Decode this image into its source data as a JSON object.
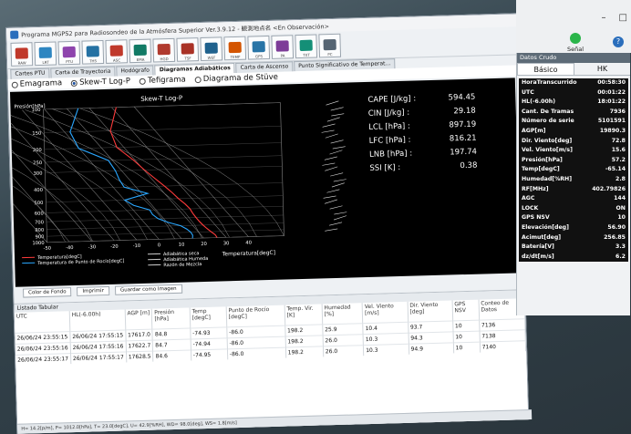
{
  "window": {
    "title": "Programa MGPS2 para Radiosondeo de la Atmósfera Superior Ver.3.9.12 - 観測地点名 <En Observación>"
  },
  "toolbar": {
    "buttons": [
      "RAW",
      "LRT",
      "PTU",
      "THS",
      "ASC",
      "EMA",
      "HGD",
      "TSF",
      "WEF",
      "TEMP",
      "GPS",
      "PA",
      "TXT",
      "PC"
    ]
  },
  "tabs": [
    "Cartes PTU",
    "Carta de Trayectoria",
    "Hodógrafo",
    "Diagramas Adiabáticos",
    "Carta de Ascenso",
    "Punto Significativo de Temperat..."
  ],
  "diagram_types": [
    "Emagrama",
    "Skew-T Log-P",
    "Tefigrama",
    "Diagrama de Stüve"
  ],
  "selected_diagram": "Skew-T Log-P",
  "plot": {
    "title": "Skew-T Log-P",
    "ylabel": "Presión[hPa]",
    "xlabel": "Temperatura[degC]",
    "pressure_ticks": [
      "100",
      "150",
      "200",
      "250",
      "300",
      "400",
      "500",
      "600",
      "700",
      "800",
      "900",
      "1000"
    ],
    "temp_ticks": [
      "-50",
      "-40",
      "-30",
      "-20",
      "-10",
      "0",
      "10",
      "20",
      "30",
      "40"
    ],
    "legend": [
      {
        "label": "Temperatura[degC]",
        "color": "#ff3b3b"
      },
      {
        "label": "Temperatura de Punto de Rocío[degC]",
        "color": "#2aa7ff"
      },
      {
        "label": "Adiabática seca",
        "color": "#cccccc"
      },
      {
        "label": "Adiabática Humeda",
        "color": "#cccccc"
      },
      {
        "label": "Razón de Mezcla",
        "color": "#cccccc"
      }
    ],
    "indices": [
      {
        "label": "CAPE [J/kg] :",
        "value": "594.45"
      },
      {
        "label": "CIN [J/kg] :",
        "value": "29.18"
      },
      {
        "label": "LCL [hPa] :",
        "value": "897.19"
      },
      {
        "label": "LFC [hPa] :",
        "value": "816.21"
      },
      {
        "label": "LNB [hPa] :",
        "value": "197.74"
      },
      {
        "label": "SSI [K] :",
        "value": "0.38"
      }
    ]
  },
  "buttons": [
    "Color de Fondo",
    "Imprimir",
    "Guardar como Imagen"
  ],
  "tabular": {
    "title": "Listado Tabular",
    "columns": [
      "UTC",
      "HL(-6.00h)",
      "AGP [m]",
      "Presión [hPa]",
      "Temp [degC]",
      "Punto de Rocío [degC]",
      "Temp. Vir. [K]",
      "Humedad [%]",
      "Vel. Viento [m/s]",
      "Dir. Viento [deg]",
      "GPS NSV",
      "Conteo de Datos"
    ],
    "rows": [
      [
        "26/06/24 23:55:15",
        "26/06/24 17:55:15",
        "17617.0",
        "84.8",
        "-74.93",
        "-86.0",
        "198.2",
        "25.9",
        "10.4",
        "93.7",
        "10",
        "7136"
      ],
      [
        "26/06/24 23:55:16",
        "26/06/24 17:55:16",
        "17622.7",
        "84.7",
        "-74.94",
        "-86.0",
        "198.2",
        "26.0",
        "10.3",
        "94.3",
        "10",
        "7138"
      ],
      [
        "26/06/24 23:55:17",
        "26/06/24 17:55:17",
        "17628.5",
        "84.6",
        "-74.95",
        "-86.0",
        "198.2",
        "26.0",
        "10.3",
        "94.9",
        "10",
        "7140"
      ]
    ]
  },
  "statusbar": "H=   14.2[p/m], P=   1012.0[hPa], T=   23.0[degC], U=   42.9[%RH], WD=   98.0[deg], WS=   1.8[m/s]",
  "right_panel": {
    "title": "Datos Crudo",
    "tabs": [
      "Básico",
      "HK"
    ],
    "signal_label": "Señal",
    "rows": [
      {
        "label": "HoraTranscurrido",
        "value": "00:58:30"
      },
      {
        "label": "UTC",
        "value": "00:01:22"
      },
      {
        "label": "HL(-6.00h)",
        "value": "18:01:22"
      },
      {
        "label": "Cant. De Tramas",
        "value": "7936"
      },
      {
        "label": "Número de serie",
        "value": "5101591"
      },
      {
        "label": "AGP[m]",
        "value": "19890.3"
      },
      {
        "label": "Dir. Viento[deg]",
        "value": "72.8"
      },
      {
        "label": "Vel. Viento[m/s]",
        "value": "15.6"
      },
      {
        "label": "Presión[hPa]",
        "value": "57.2"
      },
      {
        "label": "Temp[degC]",
        "value": "-65.14"
      },
      {
        "label": "Humedad[%RH]",
        "value": "2.8"
      },
      {
        "label": "RF[MHz]",
        "value": "402.79826"
      },
      {
        "label": "AGC",
        "value": "144"
      },
      {
        "label": "LOCK",
        "value": "ON"
      },
      {
        "label": "GPS NSV",
        "value": "10"
      },
      {
        "label": "Elevación[deg]",
        "value": "56.90"
      },
      {
        "label": "Acimut[deg]",
        "value": "256.85"
      },
      {
        "label": "Batería[V]",
        "value": "3.3"
      },
      {
        "label": "dz/dt[m/s]",
        "value": "6.2"
      }
    ]
  }
}
